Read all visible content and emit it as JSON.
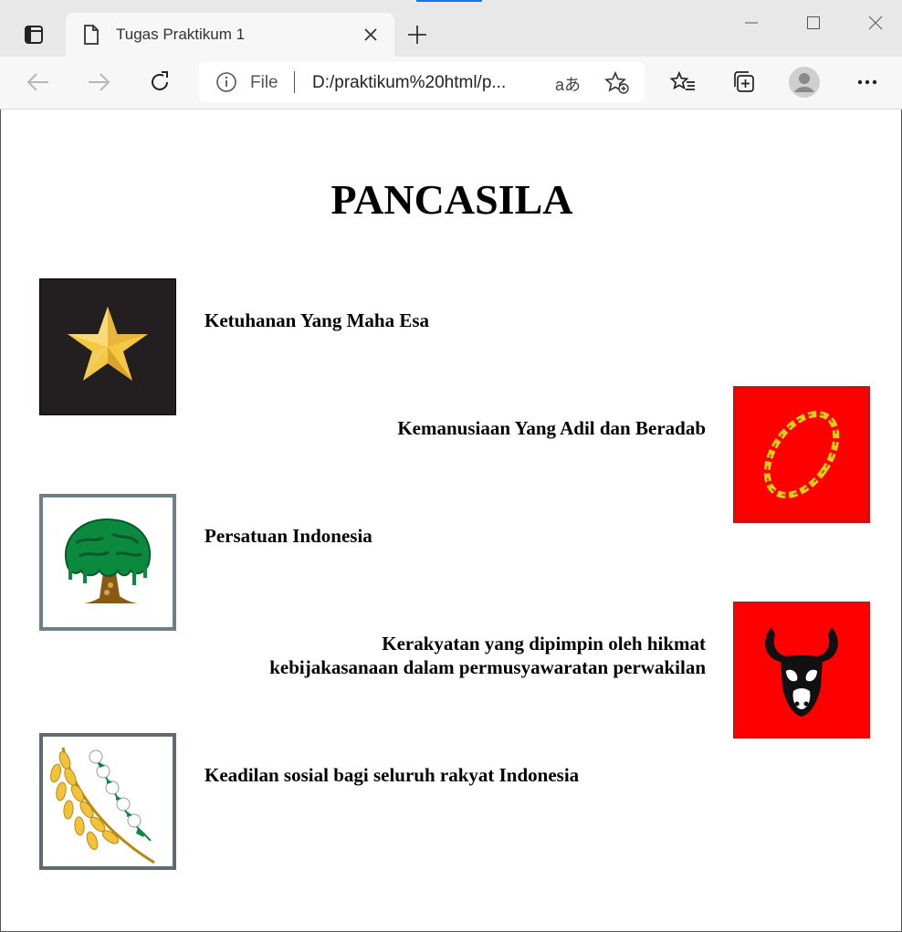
{
  "browser": {
    "tab_title": "Tugas Praktikum 1",
    "address_scheme": "File",
    "address_url": "D:/praktikum%20html/p...",
    "read_aloud_glyph": "aあ"
  },
  "page": {
    "title": "PANCASILA",
    "sila": [
      {
        "text": "Ketuhanan Yang Maha Esa",
        "icon": "star-icon"
      },
      {
        "text": "Kemanusiaan Yang Adil dan Beradab",
        "icon": "chain-icon"
      },
      {
        "text": "Persatuan Indonesia",
        "icon": "banyan-tree-icon"
      },
      {
        "line1": "Kerakyatan yang dipimpin oleh hikmat",
        "line2": "kebijakasanaan dalam permusyawaratan perwakilan",
        "icon": "bull-head-icon"
      },
      {
        "text": "Keadilan sosial bagi seluruh rakyat Indonesia",
        "icon": "rice-cotton-icon"
      }
    ]
  },
  "colors": {
    "star_bg": "#231f20",
    "red_bg": "#ff0000",
    "gold": "#f5c842",
    "tree_green": "#0b8a3e"
  }
}
